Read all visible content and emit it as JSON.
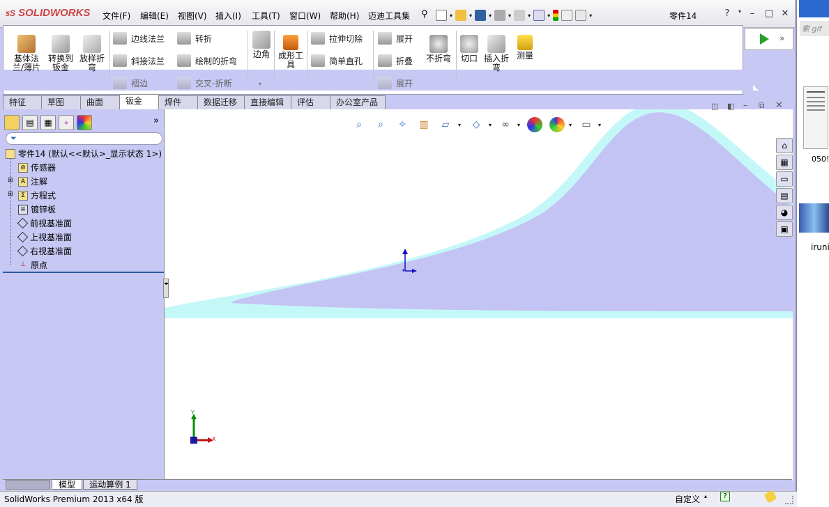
{
  "app": {
    "logo": "SOLIDWORKS",
    "document_title": "零件14"
  },
  "menu": [
    "文件(F)",
    "编辑(E)",
    "视图(V)",
    "插入(I)",
    "工具(T)",
    "窗口(W)",
    "帮助(H)",
    "迈迪工具集"
  ],
  "ribbon": {
    "large_buttons": [
      {
        "label": "基体法兰/薄片",
        "icon": "base-flange-icon"
      },
      {
        "label": "转换到钣金",
        "icon": "convert-to-sheetmetal-icon"
      },
      {
        "label": "放样折弯",
        "icon": "lofted-bend-icon"
      },
      {
        "label": "边角",
        "icon": "corners-icon"
      },
      {
        "label": "成形工具",
        "icon": "forming-tool-icon"
      },
      {
        "label": "不折弯",
        "icon": "no-bends-icon"
      },
      {
        "label": "切口",
        "icon": "rip-icon"
      },
      {
        "label": "插入折弯",
        "icon": "insert-bends-icon"
      },
      {
        "label": "测量",
        "icon": "measure-icon"
      }
    ],
    "small_buttons": [
      {
        "label": "边线法兰",
        "icon": "edge-flange-icon"
      },
      {
        "label": "斜接法兰",
        "icon": "miter-flange-icon"
      },
      {
        "label": "褶边",
        "icon": "hem-icon"
      },
      {
        "label": "转折",
        "icon": "jog-icon"
      },
      {
        "label": "绘制的折弯",
        "icon": "sketched-bend-icon"
      },
      {
        "label": "交叉-折断",
        "icon": "cross-break-icon"
      },
      {
        "label": "拉伸切除",
        "icon": "extruded-cut-icon"
      },
      {
        "label": "简单直孔",
        "icon": "simple-hole-icon"
      },
      {
        "label": "展开",
        "icon": "unfold-icon"
      },
      {
        "label": "折叠",
        "icon": "fold-icon"
      },
      {
        "label": "展开",
        "icon": "flatten-icon"
      }
    ]
  },
  "tabs": [
    "特征",
    "草图",
    "曲面",
    "钣金",
    "焊件",
    "数据迁移",
    "直接编辑",
    "评估",
    "办公室产品"
  ],
  "active_tab": "钣金",
  "tree": {
    "root": "零件14  (默认<<默认>_显示状态 1>)",
    "items": [
      {
        "label": "传感器",
        "icon": "sensor-icon"
      },
      {
        "label": "注解",
        "icon": "annotation-icon"
      },
      {
        "label": "方程式",
        "icon": "equation-icon"
      },
      {
        "label": "镀锌板",
        "icon": "material-icon"
      },
      {
        "label": "前视基准面",
        "icon": "plane-icon"
      },
      {
        "label": "上视基准面",
        "icon": "plane-icon"
      },
      {
        "label": "右视基准面",
        "icon": "plane-icon"
      },
      {
        "label": "原点",
        "icon": "origin-icon"
      }
    ]
  },
  "bottom_tabs": [
    "模型",
    "运动算例 1"
  ],
  "status": {
    "left": "SolidWorks Premium 2013 x64 版",
    "right": "自定义"
  },
  "triad": {
    "y": "Y",
    "x": "X"
  },
  "side_text": {
    "top": "索 gif",
    "mid1": "050!",
    "mid2": "iruni"
  }
}
